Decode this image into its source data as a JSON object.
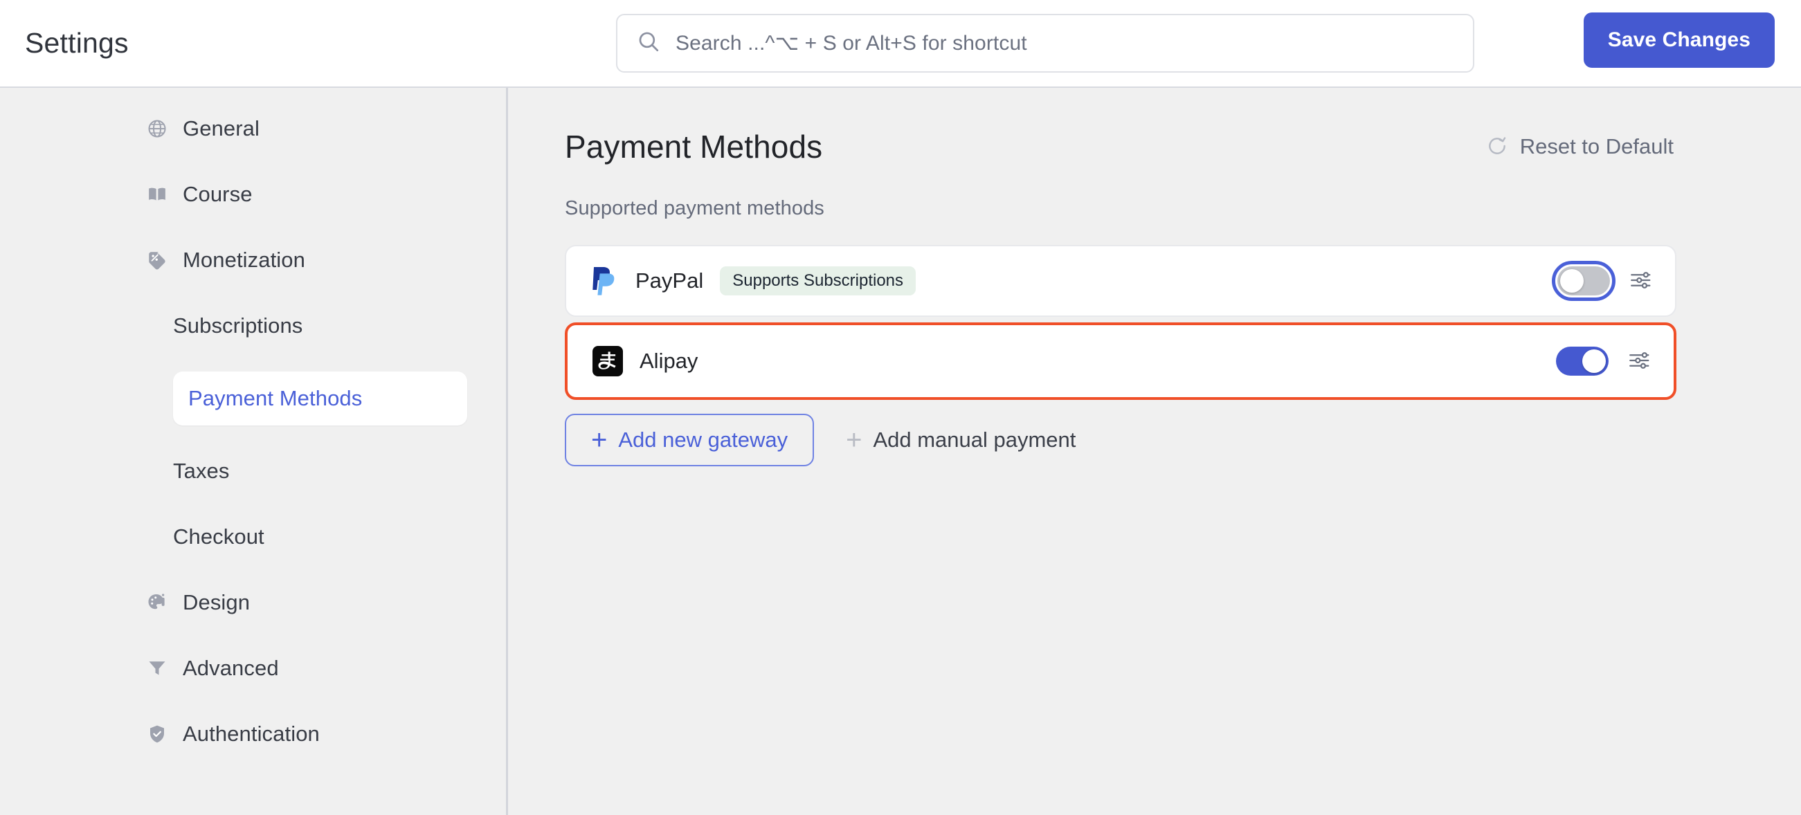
{
  "header": {
    "app_title": "Settings",
    "search": {
      "placeholder": "Search ...^⌥ + S or Alt+S for shortcut",
      "value": "",
      "icon": "search-icon"
    },
    "save_label": "Save Changes"
  },
  "sidebar": {
    "items": [
      {
        "label": "General",
        "icon": "globe-icon",
        "type": "top",
        "active": false
      },
      {
        "label": "Course",
        "icon": "book-icon",
        "type": "top",
        "active": false
      },
      {
        "label": "Monetization",
        "icon": "price-tag-percent-icon",
        "type": "top",
        "active": false
      },
      {
        "label": "Subscriptions",
        "icon": "",
        "type": "sub",
        "active": false
      },
      {
        "label": "Payment Methods",
        "icon": "",
        "type": "sub",
        "active": true
      },
      {
        "label": "Taxes",
        "icon": "",
        "type": "sub",
        "active": false
      },
      {
        "label": "Checkout",
        "icon": "",
        "type": "sub",
        "active": false
      },
      {
        "label": "Design",
        "icon": "palette-brush-icon",
        "type": "top",
        "active": false
      },
      {
        "label": "Advanced",
        "icon": "funnel-icon",
        "type": "top",
        "active": false
      },
      {
        "label": "Authentication",
        "icon": "shield-check-icon",
        "type": "top",
        "active": false
      }
    ]
  },
  "main": {
    "page_title": "Payment Methods",
    "reset_label": "Reset to Default",
    "reset_icon": "refresh-icon",
    "section_subtitle": "Supported payment methods",
    "methods": [
      {
        "name": "PayPal",
        "logo": "paypal-logo",
        "badge": "Supports Subscriptions",
        "enabled": false,
        "focused": true,
        "highlighted": false,
        "settings_icon": "sliders-icon"
      },
      {
        "name": "Alipay",
        "logo": "alipay-logo",
        "badge": "",
        "enabled": true,
        "focused": false,
        "highlighted": true,
        "settings_icon": "sliders-icon"
      }
    ],
    "actions": {
      "add_gateway_label": "Add new gateway",
      "add_gateway_icon": "plus-icon",
      "add_manual_label": "Add manual payment",
      "add_manual_icon": "plus-icon"
    }
  },
  "colors": {
    "accent_blue": "#4559d0",
    "link_blue": "#4a60d8",
    "highlight_orange": "#f04f28",
    "badge_green_bg": "#e7f1e9",
    "page_bg": "#f0f0f0",
    "card_bg": "#ffffff"
  }
}
